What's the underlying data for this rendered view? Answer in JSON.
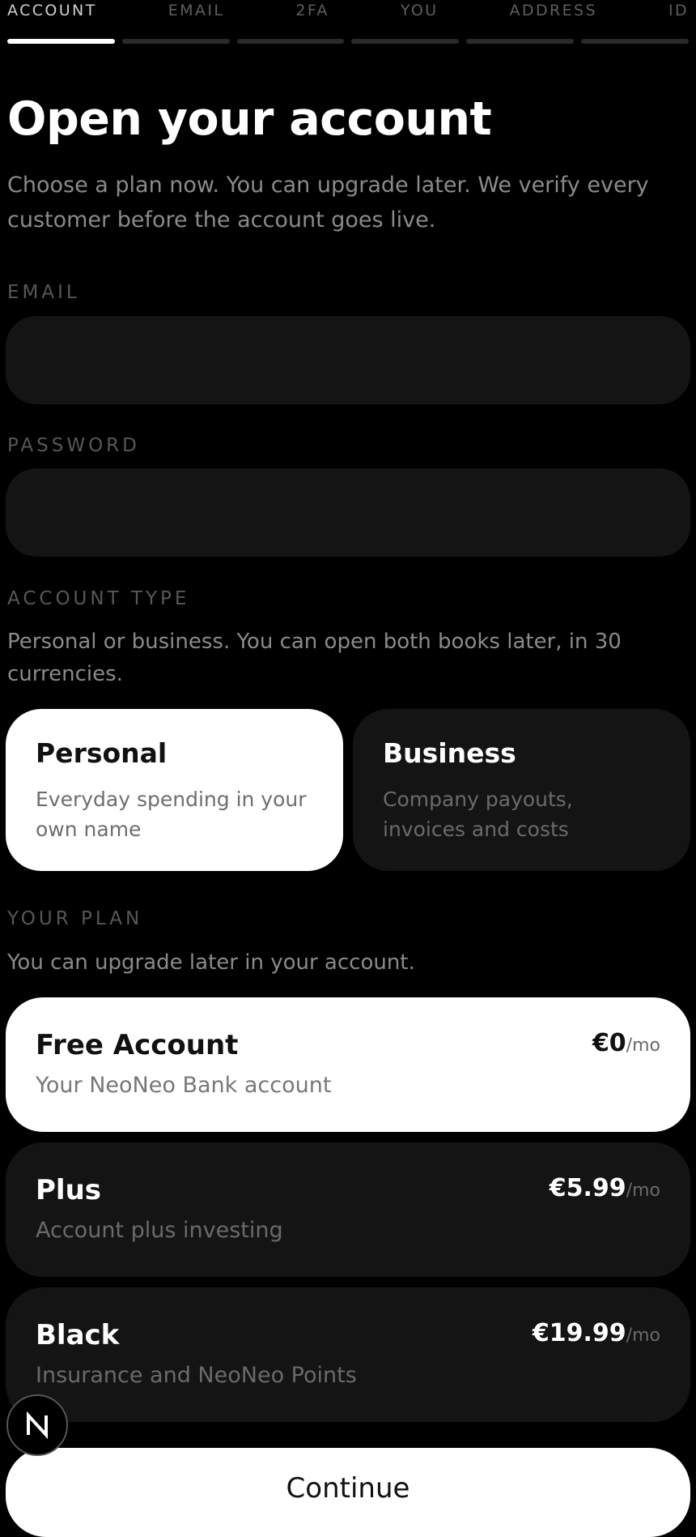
{
  "steps": {
    "labels": [
      "ACCOUNT",
      "EMAIL",
      "2FA",
      "YOU",
      "ADDRESS",
      "ID"
    ],
    "active_index": 0
  },
  "header": {
    "title": "Open your account",
    "subtitle": "Choose a plan now. You can upgrade later. We verify every customer before the account goes live."
  },
  "form": {
    "email_label": "EMAIL",
    "email_value": "",
    "password_label": "PASSWORD",
    "password_value": ""
  },
  "account_type": {
    "label": "ACCOUNT TYPE",
    "helper": "Personal or business. You can open both books later, in 30 currencies.",
    "options": [
      {
        "name": "Personal",
        "desc": "Everyday spending in your own name",
        "selected": true
      },
      {
        "name": "Business",
        "desc": "Company payouts, invoices and costs",
        "selected": false
      }
    ]
  },
  "plan": {
    "label": "YOUR PLAN",
    "helper": "You can upgrade later in your account.",
    "options": [
      {
        "name": "Free Account",
        "desc": "Your NeoNeo Bank account",
        "price": "€0",
        "per": "/mo",
        "selected": true
      },
      {
        "name": "Plus",
        "desc": "Account plus investing",
        "price": "€5.99",
        "per": "/mo",
        "selected": false
      },
      {
        "name": "Black",
        "desc": "Insurance and NeoNeo Points",
        "price": "€19.99",
        "per": "/mo",
        "selected": false
      }
    ]
  },
  "continue_label": "Continue",
  "fab": {
    "letter": "N",
    "icon": "n-logo-icon"
  },
  "colors": {
    "background": "#000000",
    "card": "#141414",
    "selected_card": "#ffffff",
    "muted_text": "#8a8a8a"
  }
}
